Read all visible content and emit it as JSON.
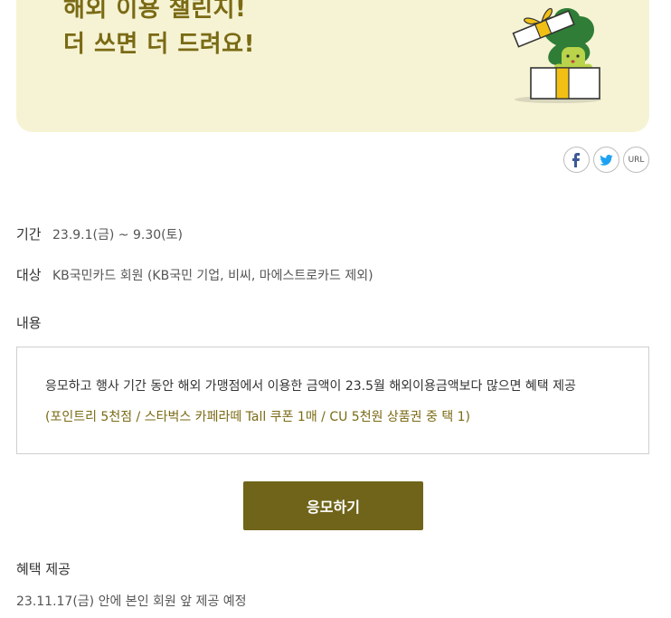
{
  "banner": {
    "line1": "해외 이용 챌린지!",
    "line2": "더 쓰면 더 드려요!"
  },
  "share": {
    "facebook_icon": "facebook-icon",
    "twitter_icon": "twitter-icon",
    "url_label": "URL"
  },
  "event": {
    "period_label": "기간",
    "period_value": "23.9.1(금) ~ 9.30(토)",
    "target_label": "대상",
    "target_value": "KB국민카드 회원 (KB국민 기업, 비씨, 마에스트로카드 제외)",
    "content_label": "내용",
    "content_line1": "응모하고 행사 기간 동안 해외 가맹점에서 이용한 금액이 23.5월 해외이용금액보다 많으면 혜택 제공",
    "content_line2": "(포인트리 5천점 / 스타벅스 카페라떼 Tall 쿠폰 1매 / CU 5천원 상품권 중 택 1)"
  },
  "apply_button": "응모하기",
  "benefit": {
    "title": "혜택 제공",
    "desc": "23.11.17(금) 안에 본인 회원 앞 제공 예정"
  },
  "colors": {
    "banner_bg": "#f5f3d3",
    "accent": "#7a6a14",
    "button_bg": "#6f6419"
  }
}
